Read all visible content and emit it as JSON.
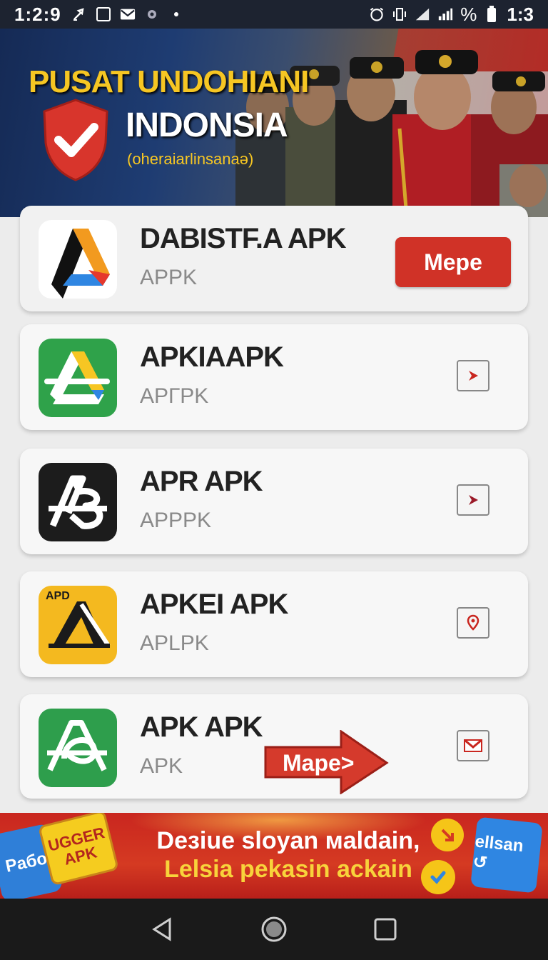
{
  "status_bar": {
    "time_left": "1:2:9",
    "time_right": "1:3",
    "battery_label": "%"
  },
  "hero": {
    "title": "PUSAT UNDOHIANI",
    "subtitle": "INDONSIA",
    "tagline": "(oheraiarlinsanaǝ)",
    "icons": [
      "shield-check-icon"
    ]
  },
  "apps": [
    {
      "name": "DABISTF.A APK",
      "subtitle": "APPK",
      "action_label": "Mepe",
      "icon": "google-drive-like-icon"
    },
    {
      "name": "APKIAAPK",
      "subtitle": "APГPK",
      "action_icon": "play-arrow-icon",
      "icon": "drive-green-icon"
    },
    {
      "name": "APR APK",
      "subtitle": "APPPK",
      "action_icon": "play-arrow-icon",
      "icon": "ab-logo-icon"
    },
    {
      "name": "APKEI APK",
      "subtitle": "APLPK",
      "action_icon": "location-pin-icon",
      "icon": "apd-logo-icon",
      "icon_text": "APD"
    },
    {
      "name": "APK APK",
      "subtitle": "APK",
      "action_icon": "mail-icon",
      "icon": "a-green-logo-icon",
      "overlay_label": "Mape>"
    }
  ],
  "ad": {
    "line1": "Deɜiue sloyan мaldain,",
    "line2": "Lelsia pekasin ackain",
    "badge_left": "Paбo",
    "badge_yellow": "UGGER APK",
    "badge_right": "ellsan ↺"
  },
  "colors": {
    "accent_red": "#d03227",
    "hero_yellow": "#f6c623",
    "status_bg": "#1d2330"
  }
}
